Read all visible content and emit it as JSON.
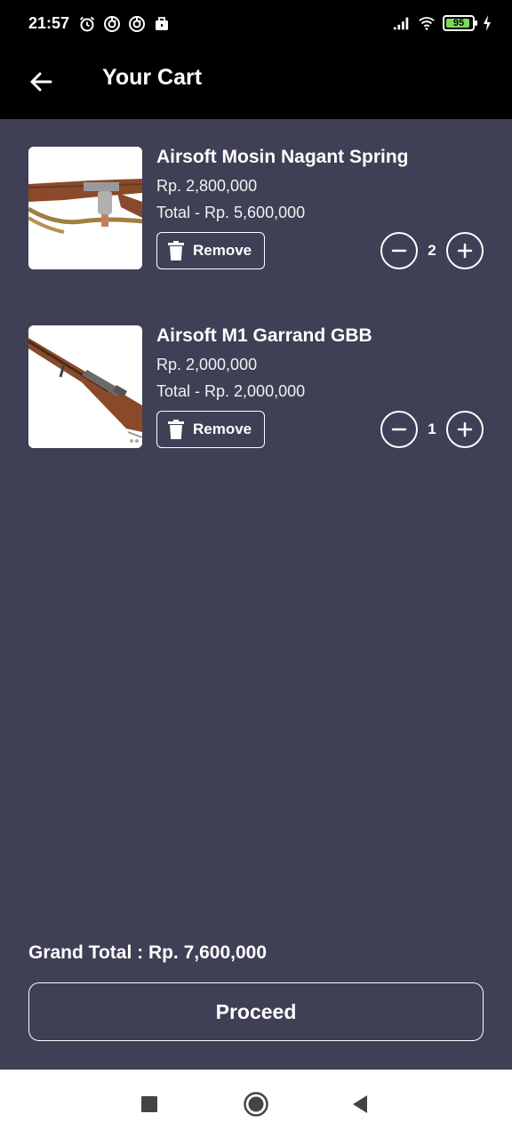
{
  "status_bar": {
    "time": "21:57",
    "battery": "95",
    "left_icons": [
      "alarm-icon",
      "sync-icon",
      "sync-icon",
      "briefcase-icon"
    ],
    "right_icons": [
      "signal-icon",
      "wifi-icon",
      "battery-icon",
      "charging-icon"
    ]
  },
  "app_bar": {
    "title": "Your Cart",
    "back_icon": "arrow-left-icon"
  },
  "cart": {
    "items": [
      {
        "name": "Airsoft Mosin Nagant Spring",
        "price": "Rp. 2,800,000",
        "total": "Total - Rp. 5,600,000",
        "remove_label": "Remove",
        "quantity": "2"
      },
      {
        "name": "Airsoft M1 Garrand GBB",
        "price": "Rp. 2,000,000",
        "total": "Total - Rp. 2,000,000",
        "remove_label": "Remove",
        "quantity": "1"
      }
    ]
  },
  "footer": {
    "grand_total": "Grand Total : Rp. 7,600,000",
    "proceed_label": "Proceed"
  },
  "nav_bar": {
    "icons": [
      "recents-square-icon",
      "home-circle-icon",
      "back-triangle-icon"
    ]
  },
  "colors": {
    "background": "#3f3f55",
    "app_bar": "#000000",
    "text": "#ffffff",
    "battery_fill": "#7ed957"
  }
}
